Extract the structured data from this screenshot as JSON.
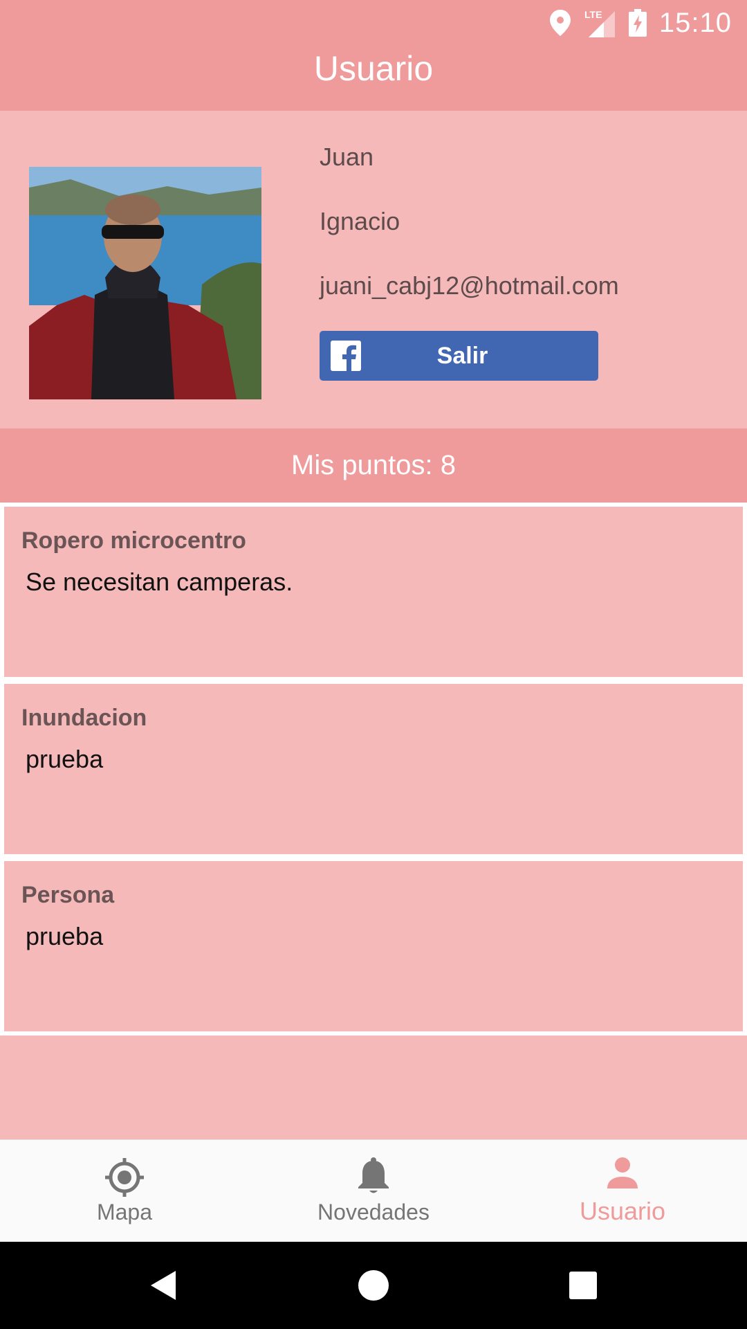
{
  "status_bar": {
    "time": "15:10",
    "network": "LTE",
    "icons": [
      "location-icon",
      "signal-icon",
      "battery-charging-icon"
    ]
  },
  "app_bar": {
    "title": "Usuario"
  },
  "profile": {
    "first_name": "Juan",
    "last_name": "Ignacio",
    "email": "juani_cabj12@hotmail.com",
    "logout_button": {
      "label": "Salir",
      "icon": "facebook-icon",
      "color": "#4267b2"
    }
  },
  "points": {
    "label": "Mis puntos: 8"
  },
  "cards": [
    {
      "title": "Ropero microcentro",
      "body": "Se necesitan camperas."
    },
    {
      "title": "Inundacion",
      "body": "prueba"
    },
    {
      "title": "Persona",
      "body": "prueba"
    }
  ],
  "bottom_nav": {
    "items": [
      {
        "label": "Mapa",
        "icon": "target-icon"
      },
      {
        "label": "Novedades",
        "icon": "bell-icon"
      },
      {
        "label": "Usuario",
        "icon": "person-icon"
      }
    ],
    "active": "Usuario"
  },
  "colors": {
    "primary": "#ef9a9b",
    "surface": "#f5b9ba",
    "facebook": "#4267b2"
  }
}
